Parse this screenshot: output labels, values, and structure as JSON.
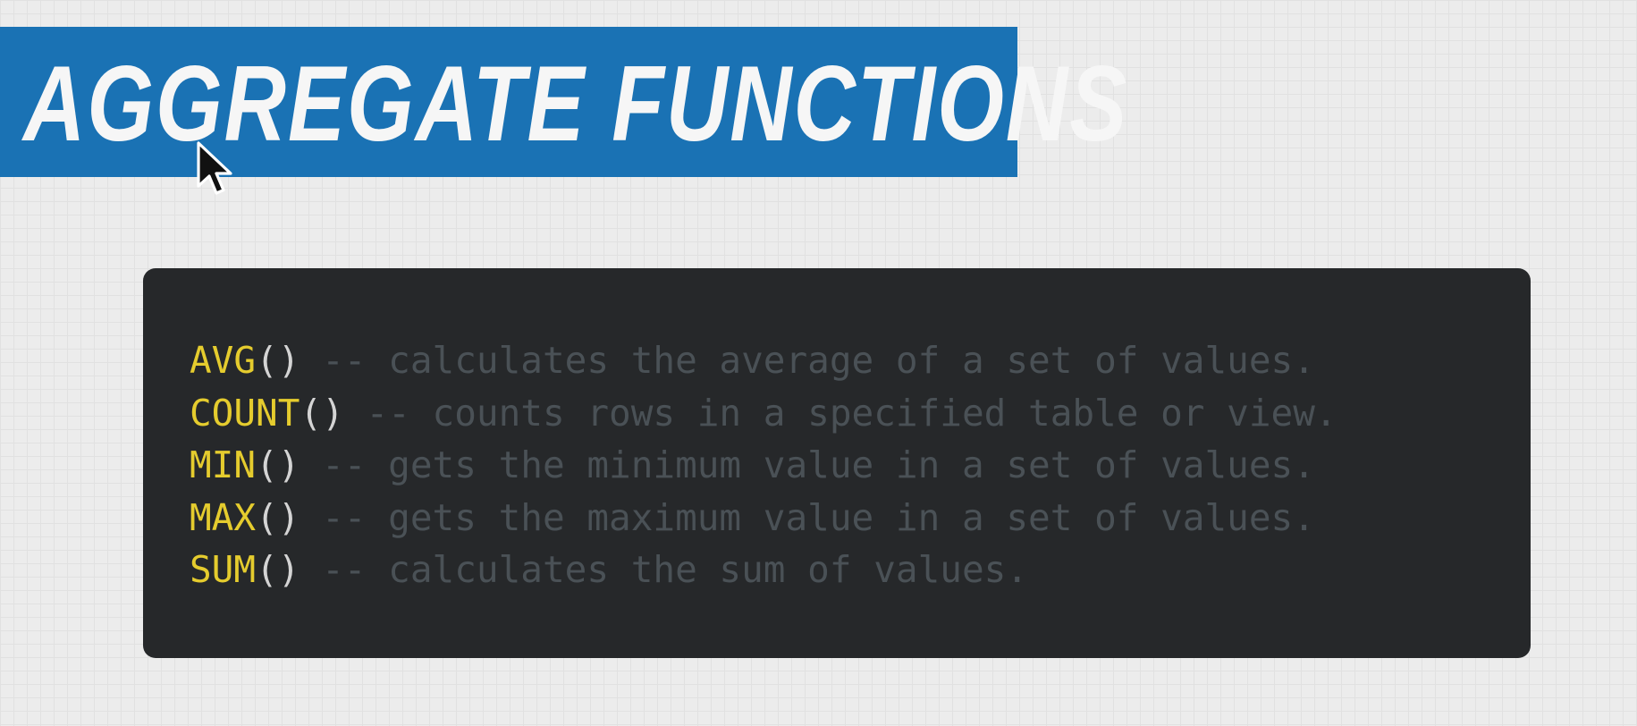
{
  "title": "AGGREGATE FUNCTIONS",
  "functions": [
    {
      "name": "AVG",
      "parens": "()",
      "comment": " -- calculates the average of a set of values."
    },
    {
      "name": "COUNT",
      "parens": "()",
      "comment": " -- counts rows in a specified table or view."
    },
    {
      "name": "MIN",
      "parens": "()",
      "comment": " -- gets the minimum value in a set of values."
    },
    {
      "name": "MAX",
      "parens": "()",
      "comment": " -- gets the maximum value in a set of values."
    },
    {
      "name": "SUM",
      "parens": "()",
      "comment": " -- calculates the sum of values."
    }
  ],
  "colors": {
    "banner": "#1a72b4",
    "panel": "#26282a",
    "function_name": "#e5cc2e",
    "parens": "#d4d4d4",
    "comment": "#4a5156"
  },
  "icons": {
    "cursor": "mouse-pointer-arrow"
  }
}
